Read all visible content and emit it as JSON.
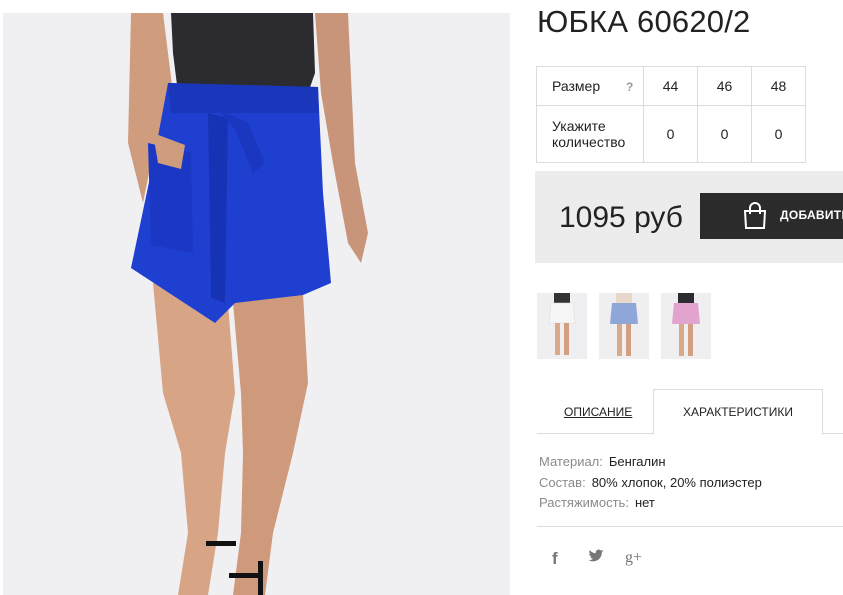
{
  "product": {
    "title": "ЮБКА 60620/2",
    "images": {
      "main": "blue-asymmetric-skirt-photo",
      "thumbnails": [
        "white-skirt-thumbnail",
        "light-blue-skirt-thumbnail",
        "pink-skirt-thumbnail"
      ]
    }
  },
  "sizes": {
    "size_label": "Размер",
    "help_icon": "?",
    "qty_label_line1": "Укажите",
    "qty_label_line2": "количество",
    "values": [
      "44",
      "46",
      "48"
    ],
    "quantities": [
      "0",
      "0",
      "0"
    ]
  },
  "buy": {
    "price": "1095 руб",
    "cart_label": "ДОБАВИТЬ",
    "cart_icon": "shopping-bag-icon"
  },
  "tabs": {
    "description": "ОПИСАНИЕ",
    "characteristics": "ХАРАКТЕРИСТИКИ",
    "active": "characteristics"
  },
  "specs": [
    {
      "key": "Материал:",
      "value": "Бенгалин"
    },
    {
      "key": "Состав:",
      "value": "80% хлопок, 20% полиэстер"
    },
    {
      "key": "Растяжимость:",
      "value": "нет"
    }
  ],
  "social": {
    "facebook": "f",
    "twitter": "twitter-bird-icon",
    "googleplus": "g+"
  },
  "colors": {
    "skirt": "#1f3fd0",
    "button_bg": "#2b2b2b",
    "buy_panel": "#ececec",
    "border": "#dcdcdc"
  }
}
